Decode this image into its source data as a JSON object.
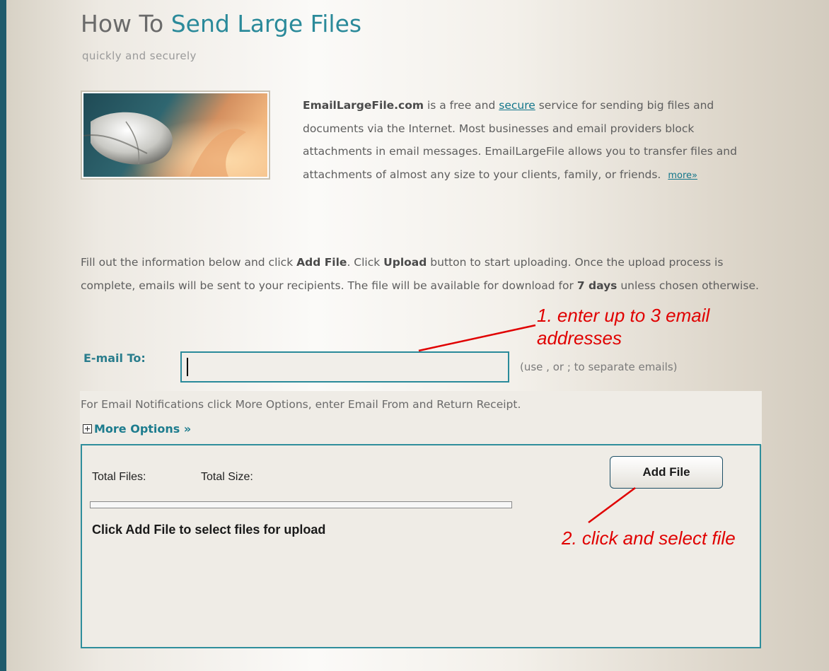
{
  "header": {
    "title_prefix": "How To ",
    "title_accent": "Send Large Files",
    "subtitle": "quickly and securely"
  },
  "intro": {
    "brand": "EmailLargeFile.com",
    "text_a": " is a free and ",
    "secure_link": "secure",
    "text_b": " service for sending big files and documents via the Internet. Most businesses and email providers block attachments in email messages. EmailLargeFile allows you to transfer files and attachments of almost any size to your clients, family, or friends.",
    "more_link": "more»"
  },
  "info": {
    "part1": "Fill out the information below and click ",
    "add_file": "Add File",
    "part2": ". Click ",
    "upload": "Upload",
    "part3": " button to start uploading. Once the upload process is complete, emails will be sent to your recipients. The file will be available for download for ",
    "days": "7 days",
    "part4": " unless chosen otherwise."
  },
  "email_form": {
    "label": "E-mail To:",
    "value": "",
    "hint": "(use , or ; to separate emails)"
  },
  "options": {
    "notification_text": "For Email Notifications click More Options, enter Email From and Return Receipt.",
    "more_options_label": "More Options »"
  },
  "upload": {
    "total_files_label": "Total Files:",
    "total_size_label": "Total Size:",
    "progress_fraction": 0,
    "instructions": "Click Add File to select files for upload",
    "add_file_button": "Add File"
  },
  "annotations": {
    "step1": "1. enter up to 3 email addresses",
    "step2": "2. click and select file"
  },
  "colors": {
    "accent": "#2b8a9a",
    "sidebar": "#1f5b6c",
    "annotation": "#e00000"
  }
}
